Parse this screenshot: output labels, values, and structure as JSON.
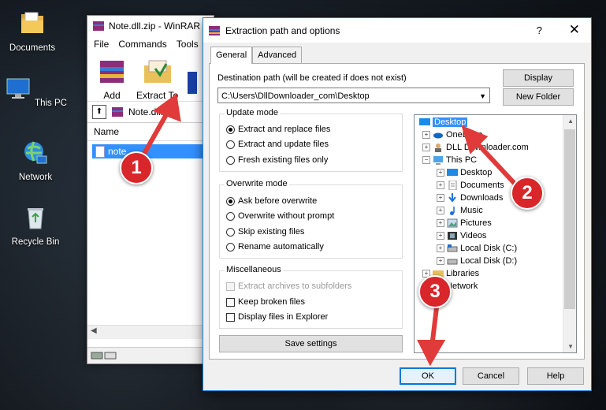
{
  "desktop": {
    "icons": [
      {
        "label": "Documents"
      },
      {
        "label": "This PC"
      },
      {
        "label": "Network"
      },
      {
        "label": "Recycle Bin"
      }
    ]
  },
  "winrar": {
    "title": "Note.dll.zip - WinRAR",
    "menu": [
      "File",
      "Commands",
      "Tools"
    ],
    "toolbar": {
      "add": "Add",
      "extract_to": "Extract To"
    },
    "address": "Note.dll.zip",
    "column_name": "Name",
    "file_name": "note"
  },
  "dialog": {
    "title": "Extraction path and options",
    "help": "?",
    "close": "✕",
    "tabs": [
      "General",
      "Advanced"
    ],
    "dest_label": "Destination path (will be created if does not exist)",
    "dest_value": "C:\\Users\\DllDownloader_com\\Desktop",
    "display_button": "Display",
    "new_folder_button": "New Folder",
    "update_mode": {
      "title": "Update mode",
      "options": [
        "Extract and replace files",
        "Extract and update files",
        "Fresh existing files only"
      ]
    },
    "overwrite_mode": {
      "title": "Overwrite mode",
      "options": [
        "Ask before overwrite",
        "Overwrite without prompt",
        "Skip existing files",
        "Rename automatically"
      ]
    },
    "misc": {
      "title": "Miscellaneous",
      "options": [
        "Extract archives to subfolders",
        "Keep broken files",
        "Display files in Explorer"
      ]
    },
    "save_settings": "Save settings",
    "tree": {
      "desktop": "Desktop",
      "onedrive": "OneDrive",
      "user": "DLL Downloader.com",
      "this_pc": "This PC",
      "pc_desktop": "Desktop",
      "documents": "Documents",
      "downloads": "Downloads",
      "music": "Music",
      "pictures": "Pictures",
      "videos": "Videos",
      "local_c": "Local Disk (C:)",
      "local_d": "Local Disk (D:)",
      "libraries": "Libraries",
      "network": "Network"
    },
    "ok": "OK",
    "cancel": "Cancel",
    "help_button": "Help"
  },
  "callouts": [
    "1",
    "2",
    "3"
  ],
  "colors": {
    "callout": "#d9262a",
    "selection": "#3390ff",
    "arrow": "#e03a3a"
  }
}
